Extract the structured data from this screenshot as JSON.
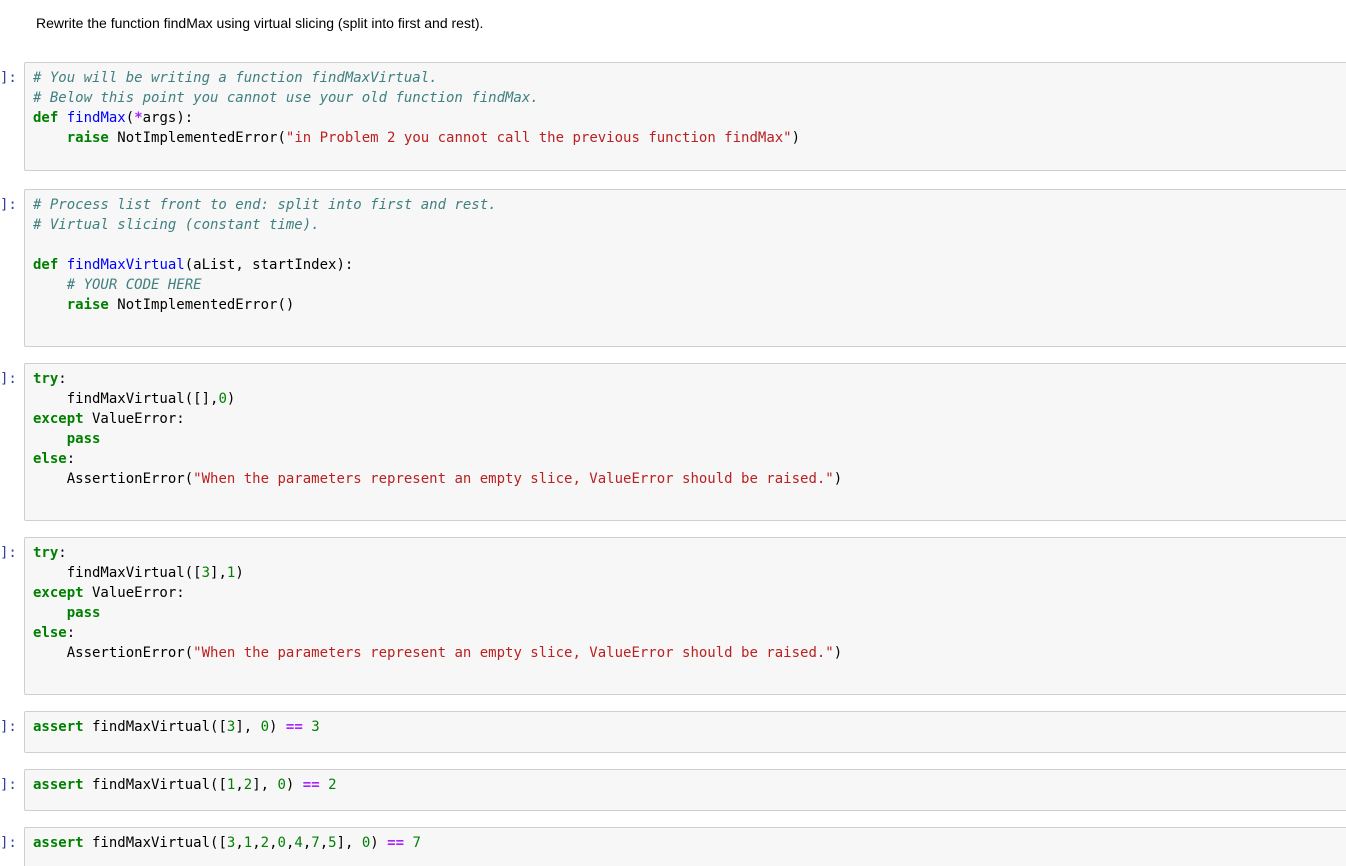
{
  "instructions": "Rewrite the function findMax using virtual slicing (split into first and rest).",
  "prompt_label": "]:",
  "cells": [
    {
      "lines": [
        [
          {
            "t": "cm",
            "v": "# You will be writing a function findMaxVirtual."
          }
        ],
        [
          {
            "t": "cm",
            "v": "# Below this point you cannot use your old function findMax."
          }
        ],
        [
          {
            "t": "kw",
            "v": "def"
          },
          {
            "t": "ex",
            "v": " "
          },
          {
            "t": "fn",
            "v": "findMax"
          },
          {
            "t": "ex",
            "v": "("
          },
          {
            "t": "op",
            "v": "*"
          },
          {
            "t": "ex",
            "v": "args):"
          }
        ],
        [
          {
            "t": "ex",
            "v": "    "
          },
          {
            "t": "kw",
            "v": "raise"
          },
          {
            "t": "ex",
            "v": " NotImplementedError("
          },
          {
            "t": "st",
            "v": "\"in Problem 2 you cannot call the previous function findMax\""
          },
          {
            "t": "ex",
            "v": ")"
          }
        ]
      ]
    },
    {
      "lines": [
        [
          {
            "t": "cm",
            "v": "# Process list front to end: split into first and rest."
          }
        ],
        [
          {
            "t": "cm",
            "v": "# Virtual slicing (constant time)."
          }
        ],
        [
          {
            "t": "ex",
            "v": ""
          }
        ],
        [
          {
            "t": "kw",
            "v": "def"
          },
          {
            "t": "ex",
            "v": " "
          },
          {
            "t": "fn",
            "v": "findMaxVirtual"
          },
          {
            "t": "ex",
            "v": "(aList, startIndex):"
          }
        ],
        [
          {
            "t": "ex",
            "v": "    "
          },
          {
            "t": "cm",
            "v": "# YOUR CODE HERE"
          }
        ],
        [
          {
            "t": "ex",
            "v": "    "
          },
          {
            "t": "kw",
            "v": "raise"
          },
          {
            "t": "ex",
            "v": " NotImplementedError()"
          }
        ]
      ]
    },
    {
      "lines": [
        [
          {
            "t": "kw",
            "v": "try"
          },
          {
            "t": "ex",
            "v": ":"
          }
        ],
        [
          {
            "t": "ex",
            "v": "    findMaxVirtual([],"
          },
          {
            "t": "nm",
            "v": "0"
          },
          {
            "t": "ex",
            "v": ")"
          }
        ],
        [
          {
            "t": "kw",
            "v": "except"
          },
          {
            "t": "ex",
            "v": " ValueError:"
          }
        ],
        [
          {
            "t": "ex",
            "v": "    "
          },
          {
            "t": "kw",
            "v": "pass"
          }
        ],
        [
          {
            "t": "kw",
            "v": "else"
          },
          {
            "t": "ex",
            "v": ":"
          }
        ],
        [
          {
            "t": "ex",
            "v": "    AssertionError("
          },
          {
            "t": "st",
            "v": "\"When the parameters represent an empty slice, ValueError should be raised.\""
          },
          {
            "t": "ex",
            "v": ")"
          }
        ]
      ]
    },
    {
      "lines": [
        [
          {
            "t": "kw",
            "v": "try"
          },
          {
            "t": "ex",
            "v": ":"
          }
        ],
        [
          {
            "t": "ex",
            "v": "    findMaxVirtual(["
          },
          {
            "t": "nm",
            "v": "3"
          },
          {
            "t": "ex",
            "v": "],"
          },
          {
            "t": "nm",
            "v": "1"
          },
          {
            "t": "ex",
            "v": ")"
          }
        ],
        [
          {
            "t": "kw",
            "v": "except"
          },
          {
            "t": "ex",
            "v": " ValueError:"
          }
        ],
        [
          {
            "t": "ex",
            "v": "    "
          },
          {
            "t": "kw",
            "v": "pass"
          }
        ],
        [
          {
            "t": "kw",
            "v": "else"
          },
          {
            "t": "ex",
            "v": ":"
          }
        ],
        [
          {
            "t": "ex",
            "v": "    AssertionError("
          },
          {
            "t": "st",
            "v": "\"When the parameters represent an empty slice, ValueError should be raised.\""
          },
          {
            "t": "ex",
            "v": ")"
          }
        ]
      ]
    },
    {
      "lines": [
        [
          {
            "t": "kw",
            "v": "assert"
          },
          {
            "t": "ex",
            "v": " findMaxVirtual(["
          },
          {
            "t": "nm",
            "v": "3"
          },
          {
            "t": "ex",
            "v": "], "
          },
          {
            "t": "nm",
            "v": "0"
          },
          {
            "t": "ex",
            "v": ") "
          },
          {
            "t": "op",
            "v": "=="
          },
          {
            "t": "ex",
            "v": " "
          },
          {
            "t": "nm",
            "v": "3"
          }
        ]
      ]
    },
    {
      "lines": [
        [
          {
            "t": "kw",
            "v": "assert"
          },
          {
            "t": "ex",
            "v": " findMaxVirtual(["
          },
          {
            "t": "nm",
            "v": "1"
          },
          {
            "t": "ex",
            "v": ","
          },
          {
            "t": "nm",
            "v": "2"
          },
          {
            "t": "ex",
            "v": "], "
          },
          {
            "t": "nm",
            "v": "0"
          },
          {
            "t": "ex",
            "v": ") "
          },
          {
            "t": "op",
            "v": "=="
          },
          {
            "t": "ex",
            "v": " "
          },
          {
            "t": "nm",
            "v": "2"
          }
        ]
      ]
    },
    {
      "lines": [
        [
          {
            "t": "kw",
            "v": "assert"
          },
          {
            "t": "ex",
            "v": " findMaxVirtual(["
          },
          {
            "t": "nm",
            "v": "3"
          },
          {
            "t": "ex",
            "v": ","
          },
          {
            "t": "nm",
            "v": "1"
          },
          {
            "t": "ex",
            "v": ","
          },
          {
            "t": "nm",
            "v": "2"
          },
          {
            "t": "ex",
            "v": ","
          },
          {
            "t": "nm",
            "v": "0"
          },
          {
            "t": "ex",
            "v": ","
          },
          {
            "t": "nm",
            "v": "4"
          },
          {
            "t": "ex",
            "v": ","
          },
          {
            "t": "nm",
            "v": "7"
          },
          {
            "t": "ex",
            "v": ","
          },
          {
            "t": "nm",
            "v": "5"
          },
          {
            "t": "ex",
            "v": "], "
          },
          {
            "t": "nm",
            "v": "0"
          },
          {
            "t": "ex",
            "v": ") "
          },
          {
            "t": "op",
            "v": "=="
          },
          {
            "t": "ex",
            "v": " "
          },
          {
            "t": "nm",
            "v": "7"
          }
        ]
      ]
    }
  ]
}
